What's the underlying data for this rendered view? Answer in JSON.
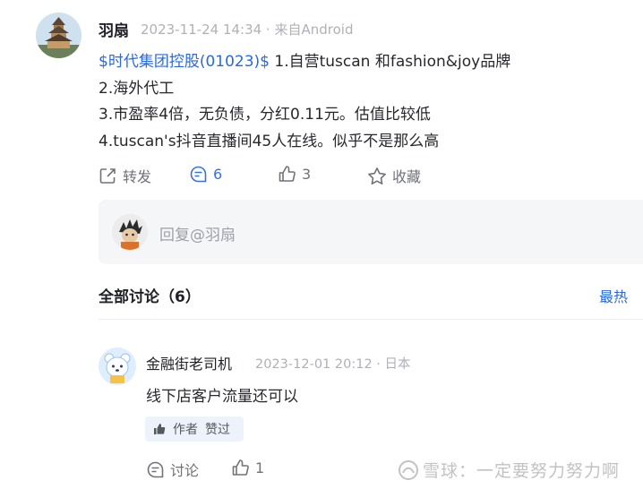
{
  "post": {
    "author": "羽扇",
    "meta": "2023-11-24 14:34 · 来自Android",
    "stock_link": "$时代集团控股(01023)$",
    "lines": [
      " 1.自营tuscan 和fashion&joy品牌",
      "2.海外代工",
      "3.市盈率4倍，无负债，分红0.11元。估值比较低",
      "4.tuscan's抖音直播间45人在线。似乎不是那么高"
    ],
    "actions": {
      "repost": "转发",
      "comments": "6",
      "likes": "3",
      "favorite": "收藏"
    },
    "icons": {
      "repost": "share-icon",
      "comments": "comment-icon",
      "likes": "thumbs-up-icon",
      "favorite": "star-icon"
    }
  },
  "reply": {
    "placeholder": "回复@羽扇"
  },
  "discussion": {
    "title": "全部讨论（6）",
    "sort": "最热"
  },
  "comments": [
    {
      "author": "金融街老司机",
      "meta": "2023-12-01 20:12 · 日本",
      "text": "线下店客户流量还可以",
      "badge_a": "作者",
      "badge_b": "赞过",
      "discuss_label": "讨论",
      "likes": "1"
    }
  ],
  "watermark": "雪球：一定要努力努力啊",
  "colors": {
    "link": "#2a6ad6",
    "active": "#3b6fd9",
    "muted": "#aeb1b8"
  }
}
